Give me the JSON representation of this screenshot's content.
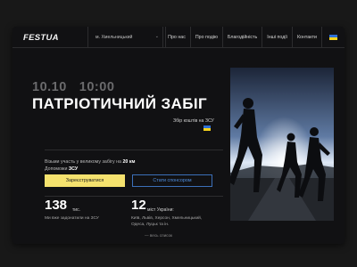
{
  "header": {
    "logo": "FESTUA",
    "city": "м. Хмельницький",
    "menu": [
      "Про нас",
      "Про подію",
      "Благодійність",
      "Інші події",
      "Контакти"
    ]
  },
  "event": {
    "date": "10.10",
    "time": "10:00",
    "title": "ПАТРІОТИЧНИЙ ЗАБІГ",
    "subtitle": "Збір коштів на ЗСУ"
  },
  "invite": {
    "line1_text": "Візьми участь у великому забігу на",
    "line1_strong": "20 км",
    "line2_text": "Допоможи",
    "line2_strong": "ЗСУ"
  },
  "actions": {
    "register_label": "Зареєструватися",
    "sponsor_label": "Стати спонсором"
  },
  "stats": {
    "raised_number": "138",
    "raised_unit": "тис.",
    "raised_desc": "Ми вже задонатили на ЗСУ",
    "cities_number": "12",
    "cities_unit": "міст України:",
    "cities_line1": "Київ, Львів, Херсон, Хмельницький,",
    "cities_line2": "Одеса, Луцьк та ін.",
    "more_label": "весь список"
  },
  "colors": {
    "accent_yellow": "#f5e26e",
    "accent_blue": "#3c6fb8",
    "background": "#111113"
  },
  "icons": {
    "city_dropdown": "chevron-down-icon",
    "language": "ukraine-flag-icon",
    "more": "arrow-right-icon"
  }
}
